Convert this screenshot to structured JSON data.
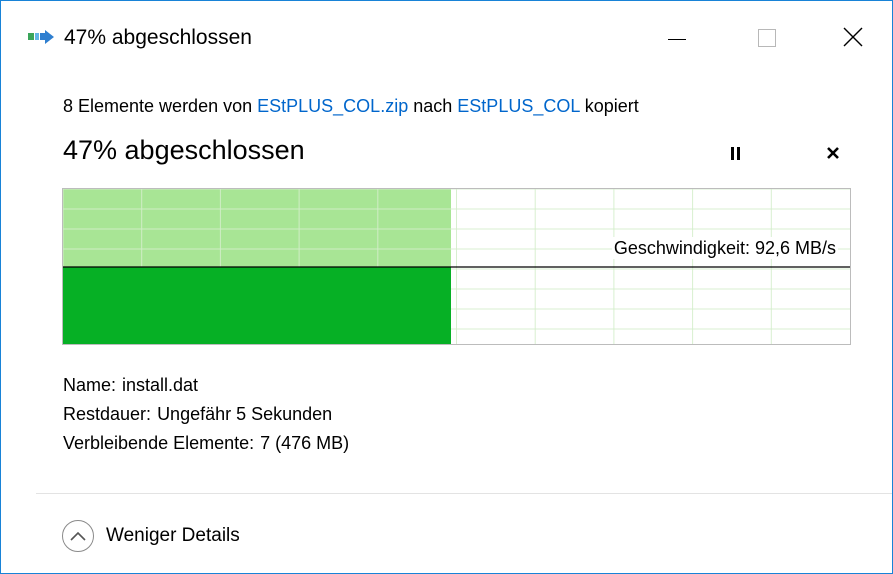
{
  "window": {
    "title": "47% abgeschlossen",
    "icon": "file-copy-icon",
    "controls": {
      "minimize": "minimize-icon",
      "maximize": "maximize-icon",
      "close": "close-icon"
    }
  },
  "copy": {
    "prefix": "8 Elemente werden von",
    "source": "EStPLUS_COL.zip",
    "middle": "nach",
    "destination": "EStPLUS_COL",
    "suffix": "kopiert"
  },
  "progress": {
    "heading": "47% abgeschlossen",
    "percent": 47,
    "speed_label": "Geschwindigkeit: 92,6 MB/s",
    "pause_icon": "pause-icon",
    "cancel_icon": "cancel-icon"
  },
  "details": {
    "name_label": "Name:",
    "name_value": "install.dat",
    "remaining_time_label": "Restdauer:",
    "remaining_time_value": "Ungefähr 5 Sekunden",
    "remaining_items_label": "Verbleibende Elemente:",
    "remaining_items_value": "7 (476 MB)"
  },
  "footer": {
    "toggle_label": "Weniger Details",
    "toggle_icon": "chevron-up-icon"
  },
  "colors": {
    "progress_fill": "#a8e595",
    "speed_fill": "#06b025",
    "grid": "#d4eecb",
    "link": "#0066cc",
    "window_border": "#1883d7"
  }
}
